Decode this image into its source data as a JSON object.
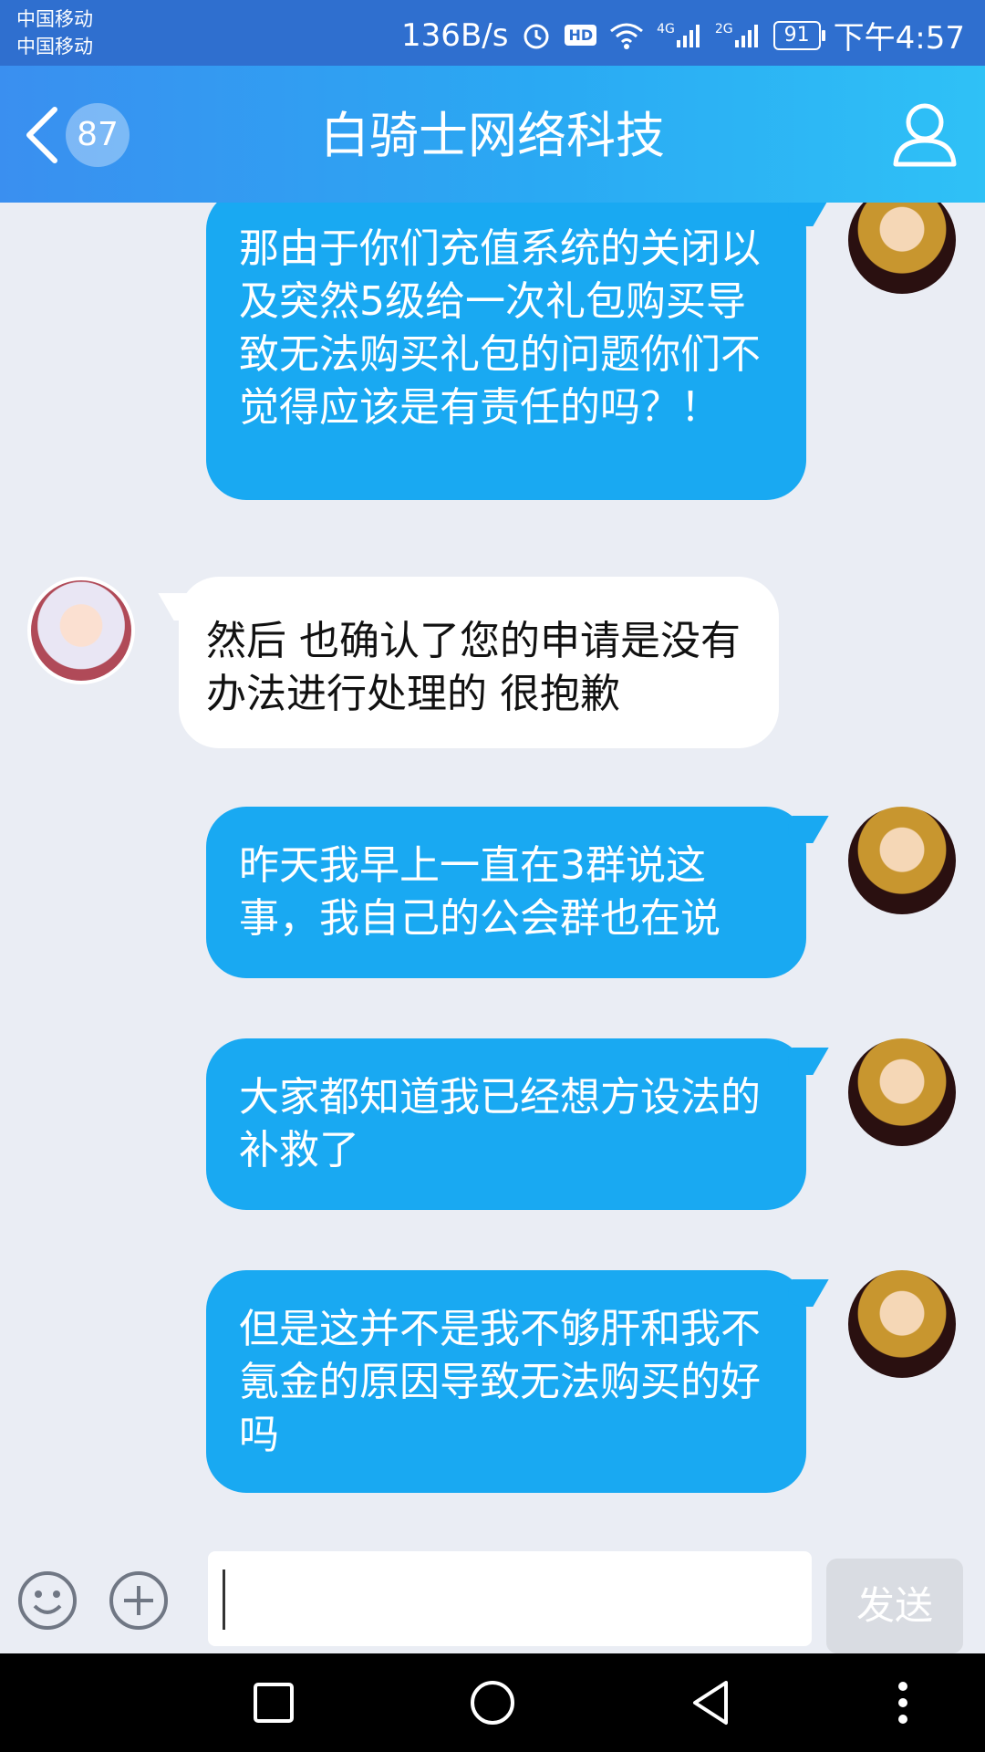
{
  "status_bar": {
    "carrier1": "中国移动",
    "carrier2": "中国移动",
    "net_speed": "136B/s",
    "hd": "HD",
    "net1": "4G",
    "net2": "2G",
    "battery": "91",
    "time": "下午4:57"
  },
  "header": {
    "back_count": "87",
    "title": "白骑士网络科技"
  },
  "messages": [
    {
      "from": "me",
      "text": "那由于你们充值系统的关闭以及突然5级给一次礼包购买导致无法购买礼包的问题你们不觉得应该是有责任的吗？！"
    },
    {
      "from": "other",
      "text": "然后 也确认了您的申请是没有办法进行处理的 很抱歉"
    },
    {
      "from": "me",
      "text": "昨天我早上一直在3群说这事，我自己的公会群也在说"
    },
    {
      "from": "me",
      "text": "大家都知道我已经想方设法的补救了"
    },
    {
      "from": "me",
      "text": "但是这并不是我不够肝和我不氪金的原因导致无法购买的好吗"
    }
  ],
  "input": {
    "value": "",
    "send_label": "发送"
  },
  "icons": {
    "back": "back-arrow-icon",
    "profile": "user-profile-icon",
    "emoji": "emoji-icon",
    "plus": "plus-icon",
    "nav_recent": "square-icon",
    "nav_home": "circle-icon",
    "nav_back": "triangle-icon",
    "nav_more": "more-dots-icon"
  },
  "colors": {
    "header_start": "#3a8ff0",
    "header_end": "#2fc1f6",
    "my_bubble": "#19a9f2",
    "other_bubble": "#ffffff",
    "chat_bg": "#eaedf4"
  }
}
